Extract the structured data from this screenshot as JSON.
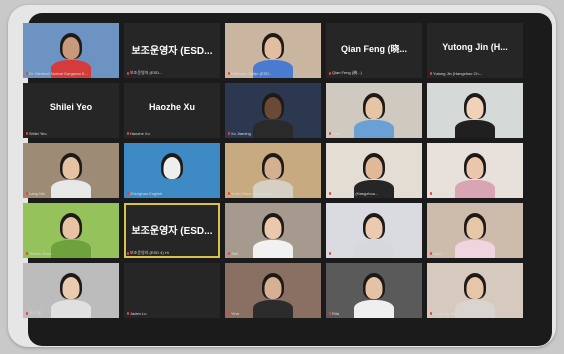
{
  "participants": [
    {
      "name": "Dr. Mehmet Nurhat Gargarao K...",
      "type": "video",
      "bg": "#6c93c1",
      "skin": "#c89a7b",
      "shirt": "#d43c3c"
    },
    {
      "name": "보조운영자 (ESD...",
      "type": "name",
      "label": "보조운영자 (ESD..."
    },
    {
      "name": "Hanbyeo Taejin (ESD...",
      "type": "video",
      "bg": "#c9b5a0",
      "skin": "#e2bda0",
      "shirt": "#4a7bd0"
    },
    {
      "name": "Qian Feng (晓...)",
      "type": "name",
      "label": "Qian Feng (晓..."
    },
    {
      "name": "Yutong Jin (Hangzhou Ch...",
      "type": "name",
      "label": "Yutong Jin (H..."
    },
    {
      "name": "Shilei Yeo",
      "type": "name",
      "label": "Shilei Yeo"
    },
    {
      "name": "Haozhe Xu",
      "type": "name",
      "label": "Haozhe Xu"
    },
    {
      "name": "Xu Jiaming",
      "type": "video",
      "bg": "#2b3850",
      "skin": "#6b4a35",
      "shirt": "#2a2a2a"
    },
    {
      "name": "Yuna",
      "type": "video",
      "bg": "#cfc9c0",
      "skin": "#e5c5a5",
      "shirt": "#6aa0d4"
    },
    {
      "name": "",
      "type": "video",
      "bg": "#d5d9d8",
      "skin": "#efd2b8",
      "shirt": "#202020"
    },
    {
      "name": "Lang Nie",
      "type": "video",
      "bg": "#9e8b76",
      "skin": "#e4c2a2",
      "shirt": "#e7e7e7"
    },
    {
      "name": "Zhenghao English",
      "type": "video",
      "bg": "#3d8ac4",
      "skin": "#eeeeee",
      "shirt": "#3d8ac4"
    },
    {
      "name": "Yuxin Shen (Hangzhou...",
      "type": "video",
      "bg": "#c7aa80",
      "skin": "#d4b091",
      "shirt": "#d6d0c4"
    },
    {
      "name": "Zhaojing Xia (Hangzhou...",
      "type": "video",
      "bg": "#e3ddd4",
      "skin": "#dfb998",
      "shirt": "#262626"
    },
    {
      "name": "Yuan Yu",
      "type": "video",
      "bg": "#e8e0da",
      "skin": "#eac7ac",
      "shirt": "#d9a4b3"
    },
    {
      "name": "Yichen Zhou",
      "type": "video",
      "bg": "#95c25a",
      "skin": "#e6c3a4",
      "shirt": "#6ea23d"
    },
    {
      "name": "보조운영자 (ESD 4) Hi",
      "type": "name",
      "label": "보조운영자 (ESD...",
      "active": true
    },
    {
      "name": "Jiali",
      "type": "video",
      "bg": "#a69a8f",
      "skin": "#e9c8ac",
      "shirt": "#f1f1f1"
    },
    {
      "name": "Qian Ling",
      "type": "video",
      "bg": "#d9dbe0",
      "skin": "#ebcab0",
      "shirt": "#d6d8de"
    },
    {
      "name": "Liam",
      "type": "video",
      "bg": "#cdbcab",
      "skin": "#e8c6a8",
      "shirt": "#f0d5e0"
    },
    {
      "name": "王小宝",
      "type": "video",
      "bg": "#bcbcbc",
      "skin": "#ebcbb0",
      "shirt": "#e0e0e0"
    },
    {
      "name": "Jaden Lu",
      "type": "name",
      "label": ""
    },
    {
      "name": "Yina",
      "type": "video",
      "bg": "#8a6f63",
      "skin": "#d6b093",
      "shirt": "#2c2c2c"
    },
    {
      "name": "Rita",
      "type": "video",
      "bg": "#5a5a5a",
      "skin": "#e4c2a6",
      "shirt": "#efefef"
    },
    {
      "name": "Cingrong Wei",
      "type": "video",
      "bg": "#d6c9bd",
      "skin": "#e6c5a8",
      "shirt": "#d9d4cf"
    }
  ],
  "colors": {
    "active_border": "#d7c24a",
    "mic_muted": "#e0463c",
    "tile_bg": "#262626"
  }
}
